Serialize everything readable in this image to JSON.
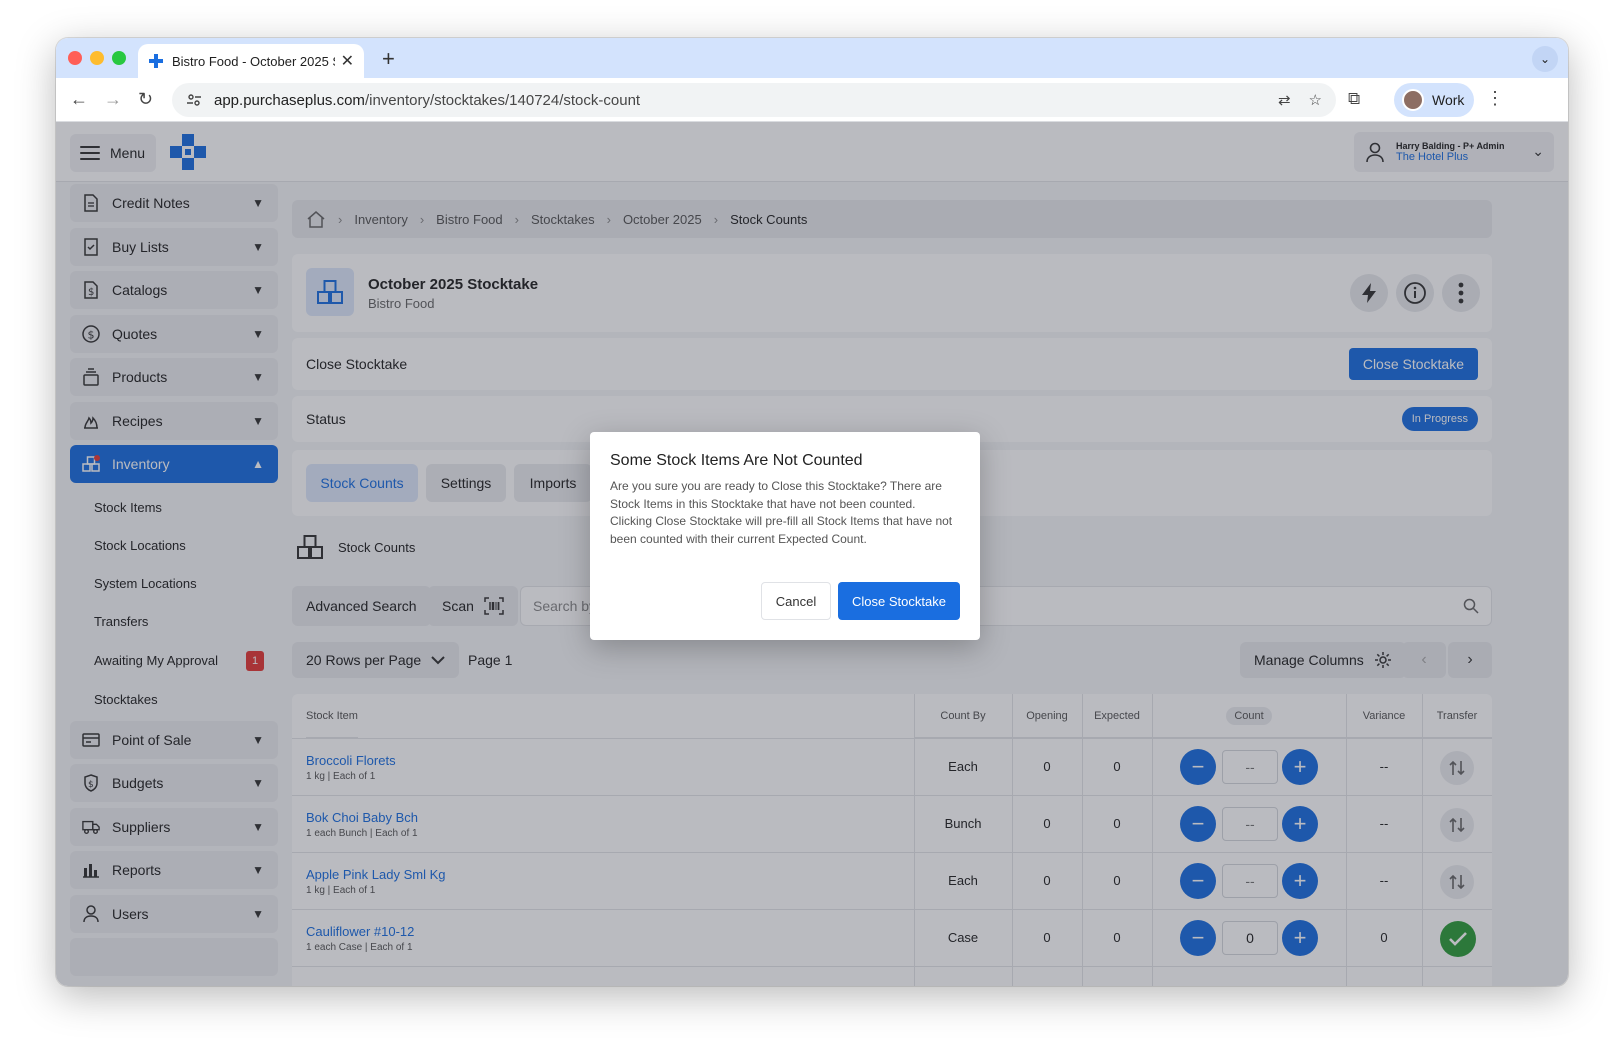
{
  "browser": {
    "tab_title": "Bistro Food - October 2025 S",
    "url_host": "app.purchaseplus.com",
    "url_path": "/inventory/stocktakes/140724/stock-count",
    "profile_label": "Work"
  },
  "topbar": {
    "menu_label": "Menu",
    "user_name": "Harry Balding - P+ Admin",
    "user_org": "The Hotel Plus"
  },
  "sidebar": {
    "items": [
      {
        "label": "Credit Notes",
        "icon": "document-icon"
      },
      {
        "label": "Buy Lists",
        "icon": "checklist-icon"
      },
      {
        "label": "Catalogs",
        "icon": "dollar-doc-icon"
      },
      {
        "label": "Quotes",
        "icon": "dollar-circle-icon"
      },
      {
        "label": "Products",
        "icon": "stack-icon"
      },
      {
        "label": "Recipes",
        "icon": "flame-icon"
      },
      {
        "label": "Inventory",
        "icon": "boxes-icon"
      }
    ],
    "inventory_sub": [
      "Stock Items",
      "Stock Locations",
      "System Locations",
      "Transfers",
      "Awaiting My Approval",
      "Stocktakes"
    ],
    "awaiting_badge": "1",
    "items_after": [
      {
        "label": "Point of Sale",
        "icon": "card-icon"
      },
      {
        "label": "Budgets",
        "icon": "shield-dollar-icon"
      },
      {
        "label": "Suppliers",
        "icon": "truck-icon"
      },
      {
        "label": "Reports",
        "icon": "bar-chart-icon"
      },
      {
        "label": "Users",
        "icon": "user-icon"
      }
    ]
  },
  "breadcrumb": [
    "Inventory",
    "Bistro Food",
    "Stocktakes",
    "October 2025",
    "Stock Counts"
  ],
  "header": {
    "title": "October 2025 Stocktake",
    "subtitle": "Bistro Food"
  },
  "close_row": {
    "label": "Close Stocktake",
    "button": "Close Stocktake"
  },
  "status_row": {
    "label": "Status",
    "value": "In Progress"
  },
  "tabs": [
    "Stock Counts",
    "Settings",
    "Imports"
  ],
  "section_title": "Stock Counts",
  "search": {
    "advanced_label": "Advanced Search",
    "scan_label": "Scan",
    "placeholder": "Search by"
  },
  "pager": {
    "rows_per_page": "20 Rows per Page",
    "page_label": "Page 1",
    "manage_columns": "Manage Columns"
  },
  "table": {
    "headers": {
      "item": "Stock Item",
      "count_by": "Count By",
      "opening": "Opening",
      "expected": "Expected",
      "count": "Count",
      "variance": "Variance",
      "transfer": "Transfer"
    },
    "rows": [
      {
        "name": "Broccoli Florets",
        "sub": "1 kg | Each of 1",
        "count_by": "Each",
        "opening": "0",
        "expected": "0",
        "count": "--",
        "variance": "--",
        "counted": false
      },
      {
        "name": "Bok Choi Baby Bch",
        "sub": "1 each Bunch | Each of 1",
        "count_by": "Bunch",
        "opening": "0",
        "expected": "0",
        "count": "--",
        "variance": "--",
        "counted": false
      },
      {
        "name": "Apple Pink Lady Sml Kg",
        "sub": "1 kg | Each of 1",
        "count_by": "Each",
        "opening": "0",
        "expected": "0",
        "count": "--",
        "variance": "--",
        "counted": false
      },
      {
        "name": "Cauliflower #10-12",
        "sub": "1 each Case | Each of 1",
        "count_by": "Case",
        "opening": "0",
        "expected": "0",
        "count": "0",
        "variance": "0",
        "counted": true
      }
    ]
  },
  "dialog": {
    "title": "Some Stock Items Are Not Counted",
    "body": "Are you sure you are ready to Close this Stocktake? There are Stock Items in this Stocktake that have not been counted. Clicking Close Stocktake will pre-fill all Stock Items that have not been counted with their current Expected Count.",
    "cancel": "Cancel",
    "confirm": "Close Stocktake"
  },
  "colors": {
    "primary": "#1a6ee0",
    "success": "#2e9d3a",
    "danger": "#e53935"
  }
}
